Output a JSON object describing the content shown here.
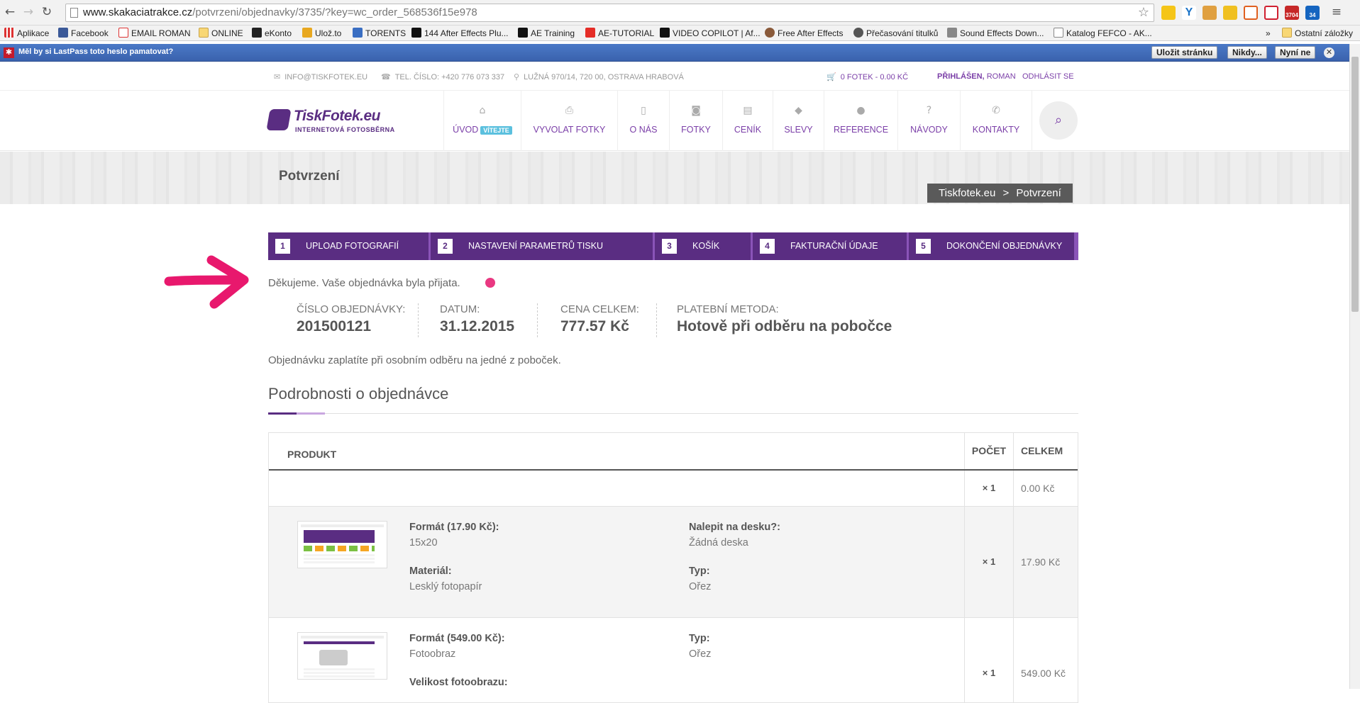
{
  "browser": {
    "url_host": "www.skakaciatrakce.cz",
    "url_path": "/potvrzeni/objednavky/3735/?key=wc_order_568536f15e978",
    "extensions": [
      "3704",
      "34"
    ],
    "bookmarks": [
      "Aplikace",
      "Facebook",
      "EMAIL ROMAN",
      "ONLINE",
      "eKonto",
      "Ulož.to",
      "TORENTS",
      "144 After Effects Plu...",
      "AE Training",
      "AE-TUTORIAL",
      "VIDEO COPILOT | Af...",
      "Free After Effects",
      "Přečasování titulků",
      "Sound Effects Down...",
      "Katalog FEFCO - AK...",
      "»",
      "Ostatní záložky"
    ],
    "lastpass": {
      "message": "Měl by si LastPass toto heslo pamatovat?",
      "save": "Uložit stránku",
      "never": "Nikdy...",
      "not_now": "Nyní ne"
    }
  },
  "topbar": {
    "email": "INFO@TISKFOTEK.EU",
    "phone": "TEL. ČÍSLO: +420 776 073 337",
    "address": "LUŽNÁ 970/14, 720 00, OSTRAVA HRABOVÁ",
    "cart": "0 FOTEK - 0.00 KČ",
    "logged_prefix": "PŘIHLÁŠEN,",
    "logged_user": "ROMAN",
    "logout": "ODHLÁSIT SE"
  },
  "logo": {
    "name": "TiskFotek.eu",
    "tagline": "INTERNETOVÁ FOTOSBĚRNA"
  },
  "menu": [
    {
      "label": "ÚVOD",
      "badge": "VÍTEJTE",
      "icon": "home-icon"
    },
    {
      "label": "VYVOLAT FOTKY",
      "icon": "print-icon"
    },
    {
      "label": "O NÁS",
      "icon": "book-icon"
    },
    {
      "label": "FOTKY",
      "icon": "camera-icon"
    },
    {
      "label": "CENÍK",
      "icon": "list-icon"
    },
    {
      "label": "SLEVY",
      "icon": "tag-icon"
    },
    {
      "label": "REFERENCE",
      "icon": "comment-icon"
    },
    {
      "label": "NÁVODY",
      "icon": "question-icon"
    },
    {
      "label": "KONTAKTY",
      "icon": "phone-icon"
    }
  ],
  "page": {
    "title": "Potvrzení",
    "breadcrumb": [
      "Tiskfotek.eu",
      ">",
      "Potvrzení"
    ]
  },
  "steps": [
    {
      "num": "1",
      "label": "UPLOAD FOTOGRAFIÍ"
    },
    {
      "num": "2",
      "label": "NASTAVENÍ PARAMETRŮ TISKU"
    },
    {
      "num": "3",
      "label": "KOŠÍK"
    },
    {
      "num": "4",
      "label": "FAKTURAČNÍ ÚDAJE"
    },
    {
      "num": "5",
      "label": "DOKONČENÍ OBJEDNÁVKY"
    }
  ],
  "confirmation": {
    "thanks": "Děkujeme. Vaše objednávka byla přijata.",
    "order_number_label": "ČÍSLO OBJEDNÁVKY:",
    "order_number": "201500121",
    "date_label": "DATUM:",
    "date": "31.12.2015",
    "total_label": "CENA CELKEM:",
    "total": "777.57 Kč",
    "payment_label": "PLATEBNÍ METODA:",
    "payment": "Hotově při odběru na pobočce",
    "payment_note": "Objednávku zaplatíte při osobním odběru na jedné z poboček."
  },
  "details": {
    "title": "Podrobnosti o objednávce",
    "headers": {
      "product": "PRODUKT",
      "qty": "POČET",
      "total": "CELKEM"
    },
    "rows": [
      {
        "qty": "× 1",
        "total": "0.00 Kč"
      },
      {
        "qty": "× 1",
        "total": "17.90 Kč",
        "a1_label": "Formát (17.90 Kč):",
        "a1_value": "15x20",
        "a2_label": "Materiál:",
        "a2_value": "Lesklý fotopapír",
        "b1_label": "Nalepit na desku?:",
        "b1_value": "Žádná deska",
        "b2_label": "Typ:",
        "b2_value": "Ořez"
      },
      {
        "qty": "× 1",
        "total": "549.00 Kč",
        "a1_label": "Formát (549.00 Kč):",
        "a1_value": "Fotoobraz",
        "a2_label": "Velikost fotoobrazu:",
        "b1_label": "Typ:",
        "b1_value": "Ořez"
      }
    ]
  }
}
